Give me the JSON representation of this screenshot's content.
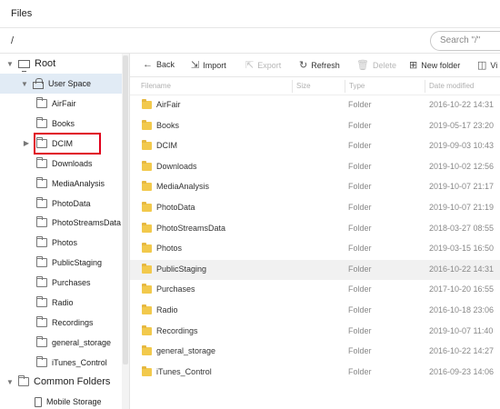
{
  "window": {
    "title": "Files"
  },
  "pathbar": {
    "path": "/",
    "search_placeholder": "Search \"/\""
  },
  "sidebar": {
    "root": "Root",
    "user_space": "User Space",
    "folders": [
      "AirFair",
      "Books",
      "DCIM",
      "Downloads",
      "MediaAnalysis",
      "PhotoData",
      "PhotoStreamsData",
      "Photos",
      "PublicStaging",
      "Purchases",
      "Radio",
      "Recordings",
      "general_storage",
      "iTunes_Control"
    ],
    "common_folders": "Common Folders",
    "mobile_storage": "Mobile Storage"
  },
  "toolbar": {
    "back": "Back",
    "import": "Import",
    "export": "Export",
    "refresh": "Refresh",
    "delete": "Delete",
    "new_folder": "New folder",
    "view": "Vi"
  },
  "table": {
    "columns": [
      "Filename",
      "Size",
      "Type",
      "Date modified"
    ],
    "rows": [
      {
        "name": "AirFair",
        "type": "Folder",
        "date": "2016-10-22 14:31"
      },
      {
        "name": "Books",
        "type": "Folder",
        "date": "2019-05-17 23:20"
      },
      {
        "name": "DCIM",
        "type": "Folder",
        "date": "2019-09-03 10:43"
      },
      {
        "name": "Downloads",
        "type": "Folder",
        "date": "2019-10-02 12:56"
      },
      {
        "name": "MediaAnalysis",
        "type": "Folder",
        "date": "2019-10-07 21:17"
      },
      {
        "name": "PhotoData",
        "type": "Folder",
        "date": "2019-10-07 21:19"
      },
      {
        "name": "PhotoStreamsData",
        "type": "Folder",
        "date": "2018-03-27 08:55"
      },
      {
        "name": "Photos",
        "type": "Folder",
        "date": "2019-03-15 16:50"
      },
      {
        "name": "PublicStaging",
        "type": "Folder",
        "date": "2016-10-22 14:31"
      },
      {
        "name": "Purchases",
        "type": "Folder",
        "date": "2017-10-20 16:55"
      },
      {
        "name": "Radio",
        "type": "Folder",
        "date": "2016-10-18 23:06"
      },
      {
        "name": "Recordings",
        "type": "Folder",
        "date": "2019-10-07 11:40"
      },
      {
        "name": "general_storage",
        "type": "Folder",
        "date": "2016-10-22 14:27"
      },
      {
        "name": "iTunes_Control",
        "type": "Folder",
        "date": "2016-09-23 14:06"
      }
    ]
  },
  "colors": {
    "selection": "#e1ebf5",
    "highlight_box": "#e0001b",
    "folder": "#f2c94c"
  }
}
